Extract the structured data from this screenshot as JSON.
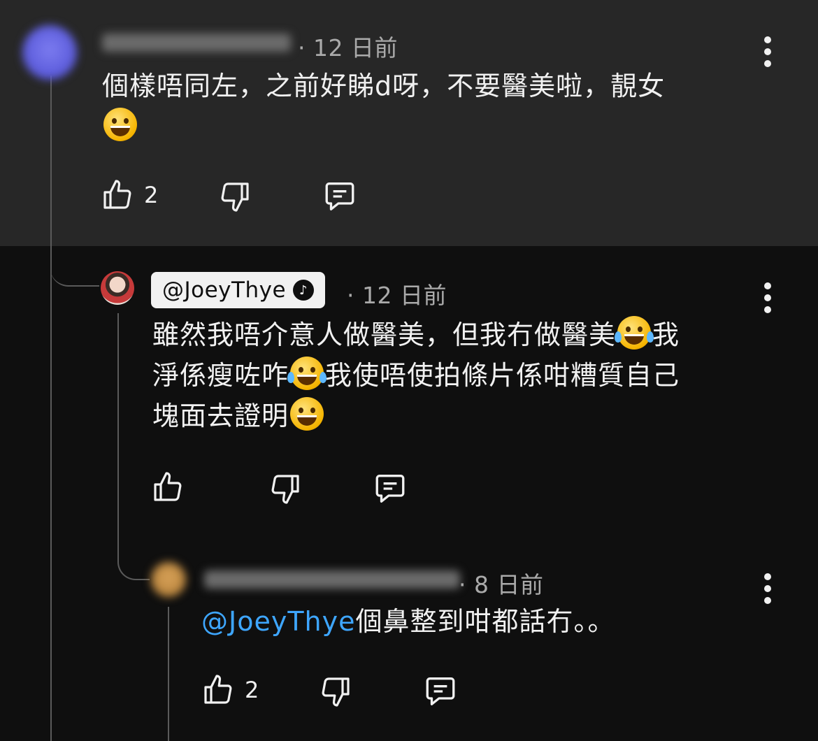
{
  "comment1": {
    "time": "12 日前",
    "text": "個樣唔同左，之前好睇d呀，不要醫美啦，靚女",
    "likes": "2"
  },
  "reply1": {
    "author": "@JoeyThye",
    "time": "12 日前",
    "line1_a": "雖然我唔介意人做醫美，但我冇做醫美",
    "line1_b": "我",
    "line2_a": "淨係瘦咗咋",
    "line2_b": "我使唔使拍條片係咁糟質自己",
    "line3_a": "塊面去證明"
  },
  "reply2": {
    "time": "8 日前",
    "mention": "@JoeyThye",
    "text": "個鼻整到咁都話冇。。",
    "likes": "2"
  },
  "icons": [
    "like-icon",
    "dislike-icon",
    "reply-icon",
    "more-vertical-icon",
    "verified-music-note-icon"
  ],
  "colors": {
    "background": "#0f0f0f",
    "highlight": "#272727",
    "mention": "#3ea6ff",
    "meta": "#aaaaaa"
  }
}
